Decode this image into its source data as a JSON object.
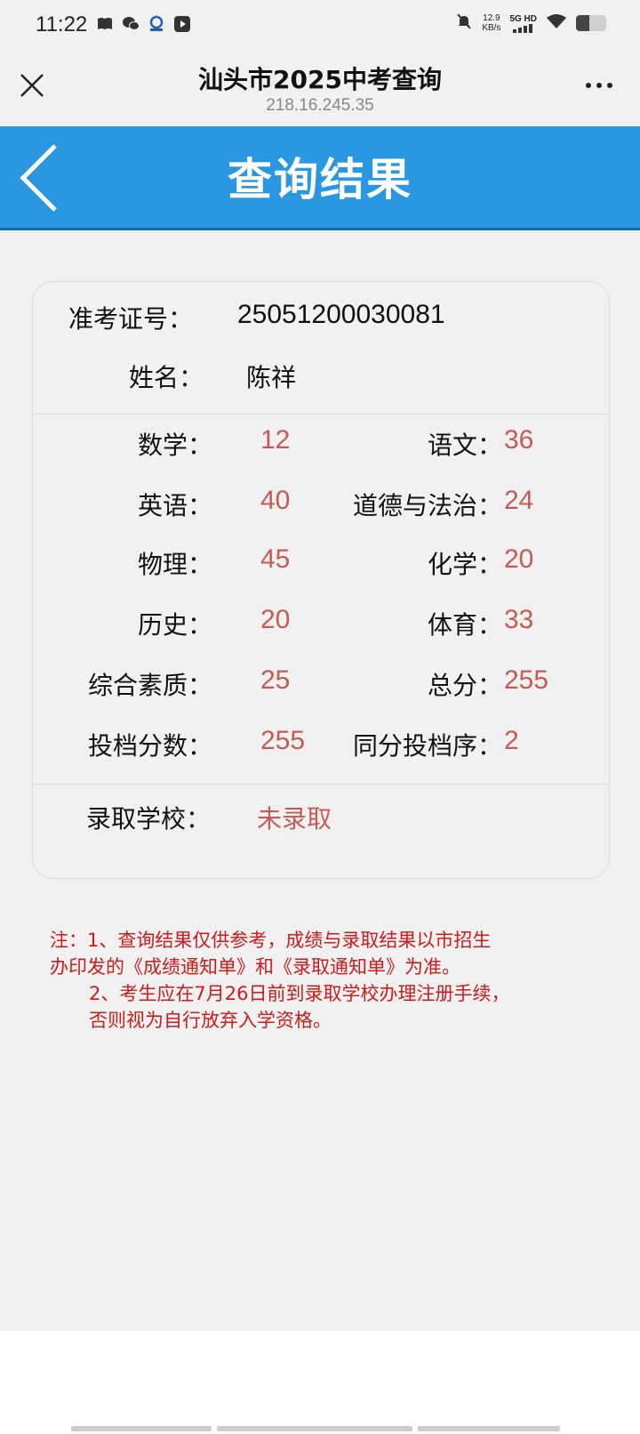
{
  "status_bar": {
    "time": "11:22",
    "speed_value": "12.9",
    "speed_unit": "KB/s",
    "network": "5G HD",
    "battery_level": 0.45
  },
  "browser": {
    "title": "汕头市2025中考查询",
    "url": "218.16.245.35"
  },
  "header": {
    "title": "查询结果"
  },
  "student": {
    "id_label": "准考证号：",
    "id_value": "25051200030081",
    "name_label": "姓名：",
    "name_value": "陈祥"
  },
  "scores": [
    {
      "left_label": "数学：",
      "left_value": "12",
      "right_label": "语文：",
      "right_value": "36"
    },
    {
      "left_label": "英语：",
      "left_value": "40",
      "right_label": "道德与法治：",
      "right_value": "24"
    },
    {
      "left_label": "物理：",
      "left_value": "45",
      "right_label": "化学：",
      "right_value": "20"
    },
    {
      "left_label": "历史：",
      "left_value": "20",
      "right_label": "体育：",
      "right_value": "33"
    },
    {
      "left_label": "综合素质：",
      "left_value": "25",
      "right_label": "总分：",
      "right_value": "255"
    },
    {
      "left_label": "投档分数：",
      "left_value": "255",
      "right_label": "同分投档序：",
      "right_value": "2"
    }
  ],
  "admission": {
    "label": "录取学校：",
    "value": "未录取"
  },
  "notes": {
    "line1": "注：1、查询结果仅供参考，成绩与录取结果以市招生",
    "line2": "办印发的《成绩通知单》和《录取通知单》为准。",
    "line3": "2、考生应在7月26日前到录取学校办理注册手续，",
    "line4": "否则视为自行放弃入学资格。"
  },
  "colors": {
    "header_bg": "#2a98e0",
    "score_color": "#c85a55",
    "note_color": "#d21a1a"
  }
}
